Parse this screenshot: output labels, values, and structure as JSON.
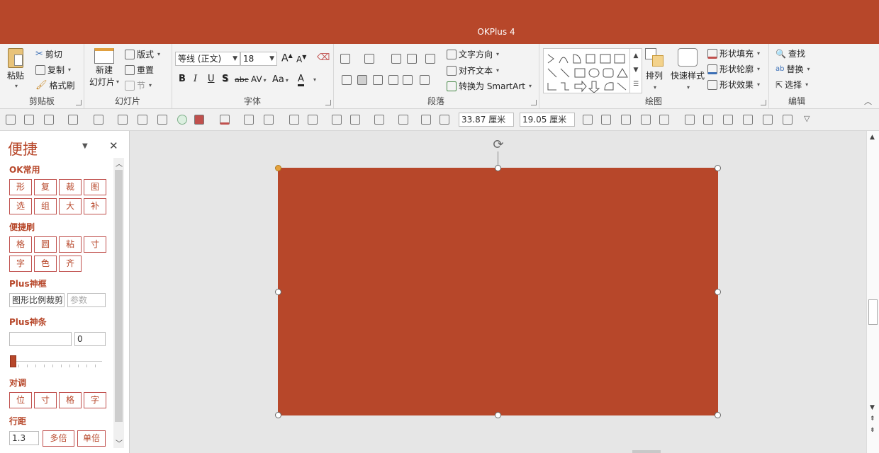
{
  "window": {
    "title": "OKPlus 4"
  },
  "ribbon": {
    "clipboard": {
      "paste": "粘贴",
      "cut": "剪切",
      "copy": "复制",
      "format_painter": "格式刷",
      "label": "剪贴板"
    },
    "slides": {
      "new_slide_line1": "新建",
      "new_slide_line2": "幻灯片",
      "layout": "版式",
      "reset": "重置",
      "section": "节",
      "label": "幻灯片"
    },
    "font": {
      "font_name": "等线 (正文)",
      "font_size": "18",
      "bold": "B",
      "italic": "I",
      "underline": "U",
      "shadow": "S",
      "strike": "abc",
      "spacing": "AV",
      "case": "Aa",
      "color": "A",
      "grow": "A",
      "shrink": "A",
      "label": "字体"
    },
    "paragraph": {
      "text_direction": "文字方向",
      "align_text": "对齐文本",
      "to_smartart": "转换为 SmartArt",
      "label": "段落"
    },
    "drawing": {
      "arrange": "排列",
      "quick_styles": "快速样式",
      "shape_fill": "形状填充",
      "shape_outline": "形状轮廓",
      "shape_effects": "形状效果",
      "label": "绘图"
    },
    "editing": {
      "find": "查找",
      "replace": "替换",
      "select": "选择",
      "label": "编辑"
    }
  },
  "quickbar": {
    "width": "33.87 厘米",
    "height": "19.05 厘米"
  },
  "panel": {
    "title": "便捷",
    "ok_common": {
      "label": "OK常用",
      "row1": [
        "形",
        "复",
        "裁",
        "图"
      ],
      "row2": [
        "选",
        "组",
        "大",
        "补"
      ]
    },
    "brush": {
      "label": "便捷刷",
      "row1": [
        "格",
        "圆",
        "粘",
        "寸"
      ],
      "row2": [
        "字",
        "色",
        "齐"
      ]
    },
    "plus_frame": {
      "label": "Plus神框",
      "value": "图形比例裁剪",
      "param_placeholder": "参数"
    },
    "plus_bar": {
      "label": "Plus神条",
      "value": "",
      "count": "0",
      "slider_value": 0
    },
    "align": {
      "label": "对调",
      "buttons": [
        "位",
        "寸",
        "格",
        "字"
      ]
    },
    "line_spacing": {
      "label": "行距",
      "value": "1.3",
      "multi": "多倍",
      "single": "单倍"
    }
  },
  "slide": {
    "fill_color": "#b7472a"
  },
  "colors": {
    "accent": "#b7472a",
    "panel_button_border": "#c0504d"
  }
}
